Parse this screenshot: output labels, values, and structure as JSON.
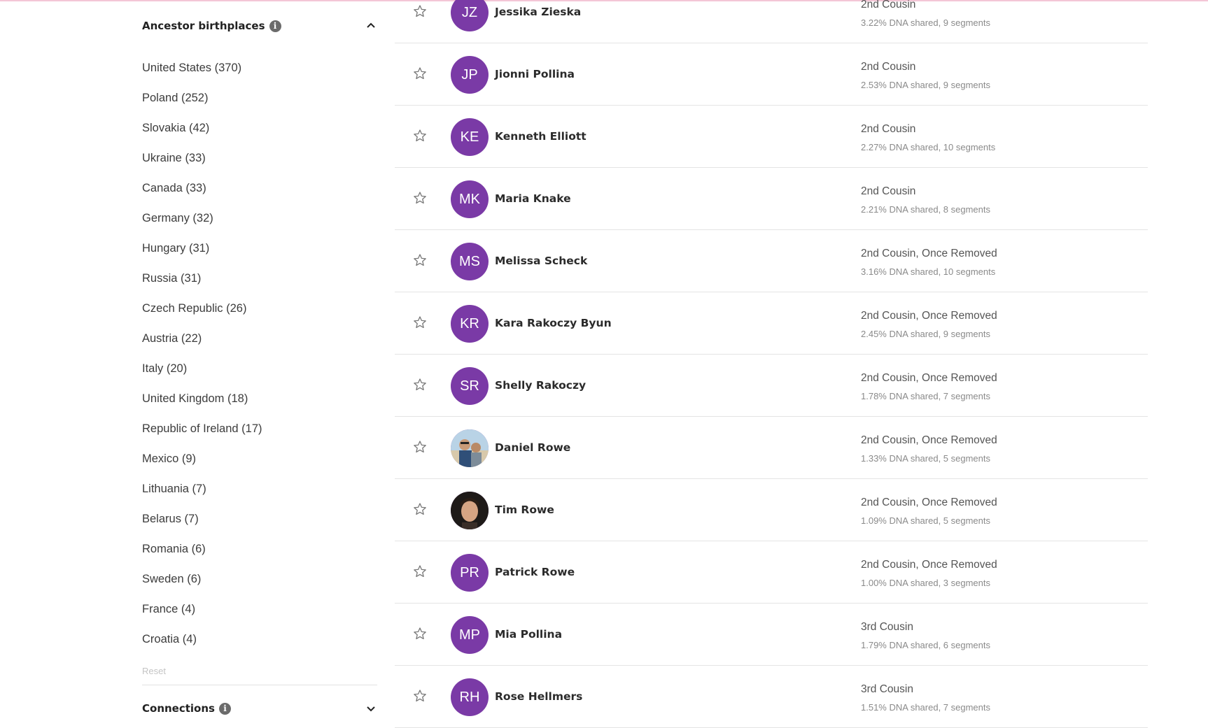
{
  "sidebar": {
    "ancestor_birthplaces": {
      "title": "Ancestor birthplaces",
      "info_icon": "info-icon",
      "toggle_icon": "chevron-up-icon",
      "items": [
        {
          "label": "United States (370)"
        },
        {
          "label": "Poland (252)"
        },
        {
          "label": "Slovakia (42)"
        },
        {
          "label": "Ukraine (33)"
        },
        {
          "label": "Canada (33)"
        },
        {
          "label": "Germany (32)"
        },
        {
          "label": "Hungary (31)"
        },
        {
          "label": "Russia (31)"
        },
        {
          "label": "Czech Republic (26)"
        },
        {
          "label": "Austria (22)"
        },
        {
          "label": "Italy (20)"
        },
        {
          "label": "United Kingdom (18)"
        },
        {
          "label": "Republic of Ireland (17)"
        },
        {
          "label": "Mexico (9)"
        },
        {
          "label": "Lithuania (7)"
        },
        {
          "label": "Belarus (7)"
        },
        {
          "label": "Romania (6)"
        },
        {
          "label": "Sweden (6)"
        },
        {
          "label": "France (4)"
        },
        {
          "label": "Croatia (4)"
        }
      ],
      "reset_label": "Reset"
    },
    "connections": {
      "title": "Connections",
      "info_icon": "info-icon",
      "toggle_icon": "chevron-down-icon"
    }
  },
  "matches": [
    {
      "initials": "JZ",
      "name": "Jessika Zieska",
      "relationship": "2nd Cousin",
      "dna": "3.22% DNA shared, 9 segments"
    },
    {
      "initials": "JP",
      "name": "Jionni Pollina",
      "relationship": "2nd Cousin",
      "dna": "2.53% DNA shared, 9 segments"
    },
    {
      "initials": "KE",
      "name": "Kenneth Elliott",
      "relationship": "2nd Cousin",
      "dna": "2.27% DNA shared, 10 segments"
    },
    {
      "initials": "MK",
      "name": "Maria Knake",
      "relationship": "2nd Cousin",
      "dna": "2.21% DNA shared, 8 segments"
    },
    {
      "initials": "MS",
      "name": "Melissa Scheck",
      "relationship": "2nd Cousin, Once Removed",
      "dna": "3.16% DNA shared, 10 segments"
    },
    {
      "initials": "KR",
      "name": "Kara Rakoczy Byun",
      "relationship": "2nd Cousin, Once Removed",
      "dna": "2.45% DNA shared, 9 segments"
    },
    {
      "initials": "SR",
      "name": "Shelly Rakoczy",
      "relationship": "2nd Cousin, Once Removed",
      "dna": "1.78% DNA shared, 7 segments"
    },
    {
      "initials": "",
      "photo": "photo-beach",
      "name": "Daniel Rowe",
      "relationship": "2nd Cousin, Once Removed",
      "dna": "1.33% DNA shared, 5 segments"
    },
    {
      "initials": "",
      "photo": "photo-portrait",
      "name": "Tim Rowe",
      "relationship": "2nd Cousin, Once Removed",
      "dna": "1.09% DNA shared, 5 segments"
    },
    {
      "initials": "PR",
      "name": "Patrick Rowe",
      "relationship": "2nd Cousin, Once Removed",
      "dna": "1.00% DNA shared, 3 segments"
    },
    {
      "initials": "MP",
      "name": "Mia Pollina",
      "relationship": "3rd Cousin",
      "dna": "1.79% DNA shared, 6 segments"
    },
    {
      "initials": "RH",
      "name": "Rose Hellmers",
      "relationship": "3rd Cousin",
      "dna": "1.51% DNA shared, 7 segments"
    }
  ],
  "colors": {
    "avatar_purple": "#7a3aa6",
    "page_background": "#ffffff",
    "top_accent": "#f4c6d6"
  }
}
